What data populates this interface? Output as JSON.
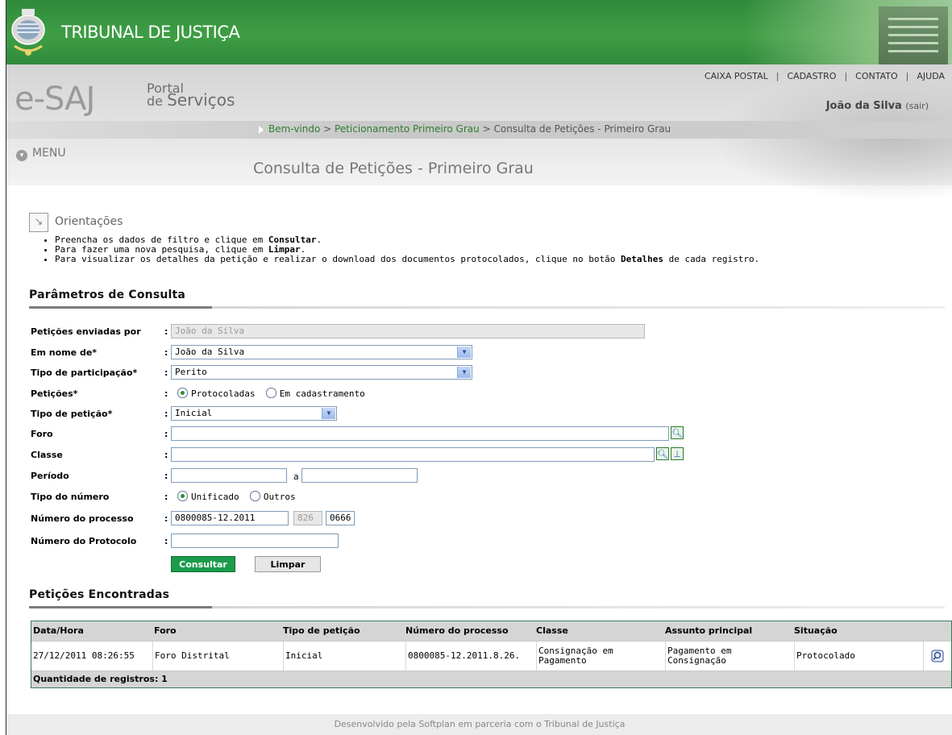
{
  "banner": {
    "court_name": "TRIBUNAL DE JUSTIÇA"
  },
  "header": {
    "logo_text": "e-SAJ",
    "portal_line1": "Portal",
    "portal_line2_prefix": "de",
    "portal_line2": "Serviços",
    "links": [
      "CAIXA POSTAL",
      "CADASTRO",
      "CONTATO",
      "AJUDA"
    ],
    "user_name": "João da Silva",
    "logout_label": "(sair)",
    "breadcrumb": {
      "home": "Bem-vindo",
      "sep1": ">",
      "parent": "Peticionamento Primeiro Grau",
      "sep2": ">",
      "current": "Consulta de Petições - Primeiro Grau"
    },
    "menu_label": "MENU",
    "page_title": "Consulta de Petições - Primeiro Grau"
  },
  "orientations": {
    "title": "Orientações",
    "items": [
      {
        "pre": "Preencha os dados de filtro e clique em ",
        "bold": "Consultar",
        "post": "."
      },
      {
        "pre": "Para fazer uma nova pesquisa, clique em ",
        "bold": "Limpar",
        "post": "."
      },
      {
        "pre": "Para visualizar os detalhes da petição e realizar o download dos documentos protocolados, clique no botão ",
        "bold": "Detalhes",
        "post": " de cada registro."
      }
    ]
  },
  "params": {
    "section_title": "Parâmetros de Consulta",
    "sent_by": {
      "label": "Petições enviadas por",
      "value": "João da Silva"
    },
    "on_behalf": {
      "label": "Em nome de",
      "required": "*",
      "value": "João da Silva"
    },
    "participation": {
      "label": "Tipo de participação",
      "required": "*",
      "value": "Perito"
    },
    "petitions": {
      "label": "Petições",
      "required": "*",
      "option1": "Protocoladas",
      "option2": "Em cadastramento",
      "selected": "Protocoladas"
    },
    "petition_type": {
      "label": "Tipo de petição",
      "required": "*",
      "value": "Inicial"
    },
    "forum": {
      "label": "Foro",
      "value": ""
    },
    "class": {
      "label": "Classe",
      "value": ""
    },
    "period": {
      "label": "Período",
      "from": "",
      "separator": "a",
      "to": ""
    },
    "number_type": {
      "label": "Tipo do número",
      "option1": "Unificado",
      "option2": "Outros",
      "selected": "Unificado"
    },
    "process_number": {
      "label": "Número do processo",
      "part1": "0800085-12.2011",
      "part2": "826",
      "part3": "0666"
    },
    "protocol_number": {
      "label": "Número do Protocolo",
      "value": ""
    },
    "colon": ":",
    "btn_consultar": "Consultar",
    "btn_limpar": "Limpar"
  },
  "results": {
    "section_title": "Petições Encontradas",
    "columns": [
      "Data/Hora",
      "Foro",
      "Tipo de petição",
      "Número do processo",
      "Classe",
      "Assunto principal",
      "Situação"
    ],
    "rows": [
      {
        "datetime": "27/12/2011 08:26:55",
        "forum": "Foro Distrital",
        "type": "Inicial",
        "process": "0800085-12.2011.8.26.",
        "class": "Consignação em Pagamento",
        "subject": "Pagamento em Consignação",
        "status": "Protocolado"
      }
    ],
    "count_label": "Quantidade de registros: 1"
  },
  "footer": {
    "text": "Desenvolvido pela Softplan em parceria com o Tribunal de Justiça"
  }
}
